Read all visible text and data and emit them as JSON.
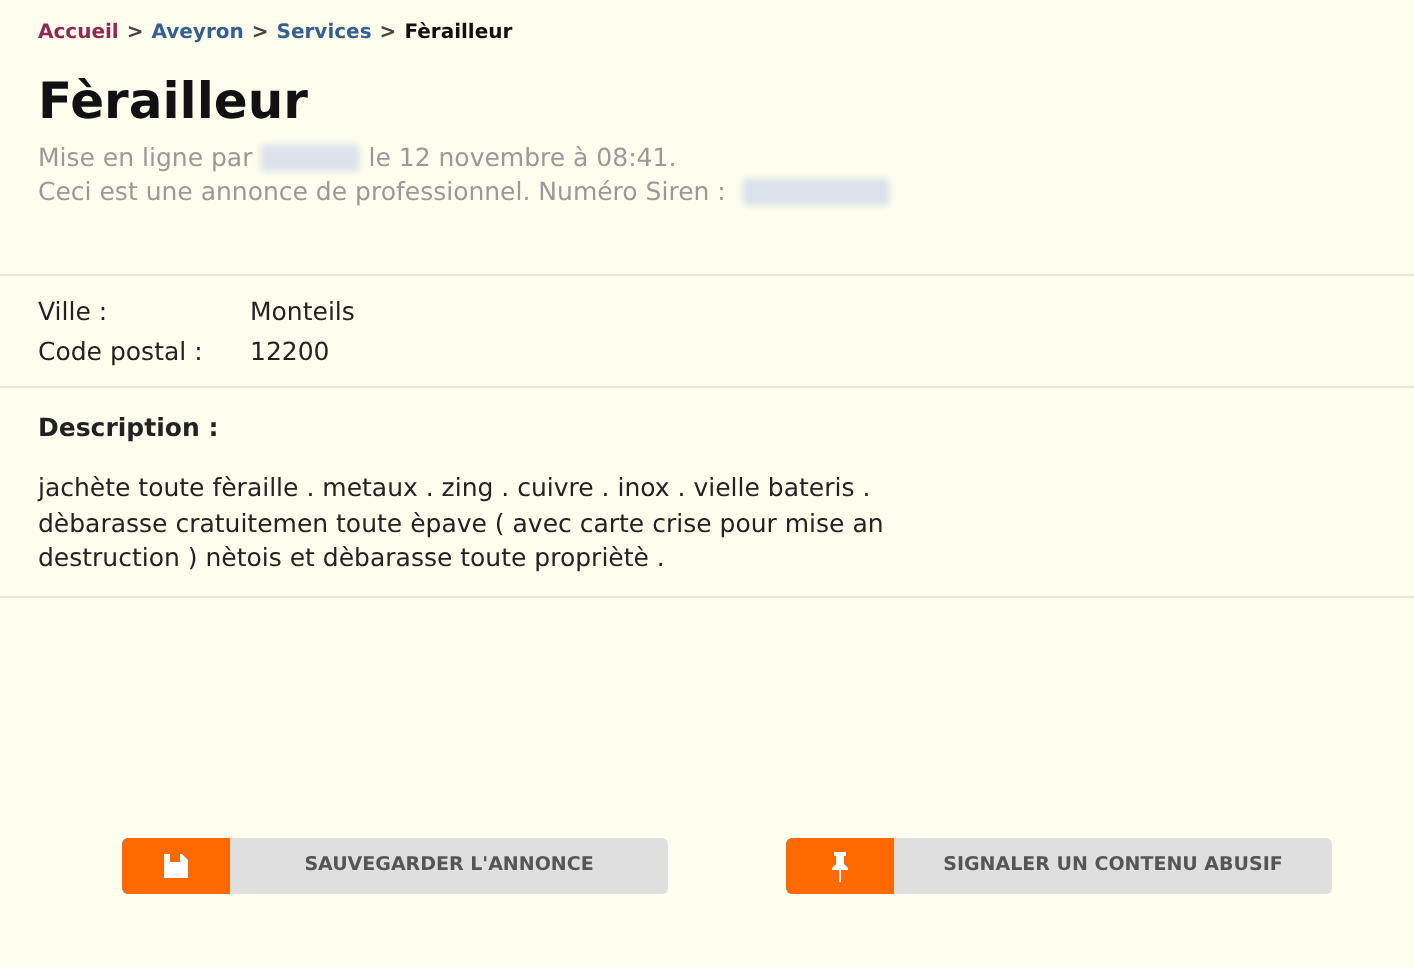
{
  "breadcrumb": [
    {
      "label": "Accueil",
      "kind": "home"
    },
    {
      "label": "Aveyron",
      "kind": "link"
    },
    {
      "label": "Services",
      "kind": "link"
    },
    {
      "label": "Fèrailleur",
      "kind": "current"
    }
  ],
  "breadcrumb_separator": ">",
  "title": "Fèrailleur",
  "posted": {
    "before": "Mise en ligne par",
    "after": "le 12 novembre à 08:41."
  },
  "pro_notice": "Ceci est une annonce de professionnel. Numéro Siren :",
  "details": [
    {
      "label": "Ville :",
      "value": "Monteils"
    },
    {
      "label": "Code postal :",
      "value": "12200"
    }
  ],
  "description": {
    "heading": "Description :",
    "lines": [
      "jachète toute fèraille . metaux . zing . cuivre . inox . vielle bateris .",
      "dèbarasse cratuitemen toute èpave ( avec carte crise pour mise an",
      "destruction ) nètois et dèbarasse toute propriètè ."
    ]
  },
  "buttons": [
    {
      "label": "SAUVEGARDER L'ANNONCE",
      "kind": "save"
    },
    {
      "label": "SIGNALER UN CONTENU ABUSIF",
      "kind": "report"
    }
  ]
}
